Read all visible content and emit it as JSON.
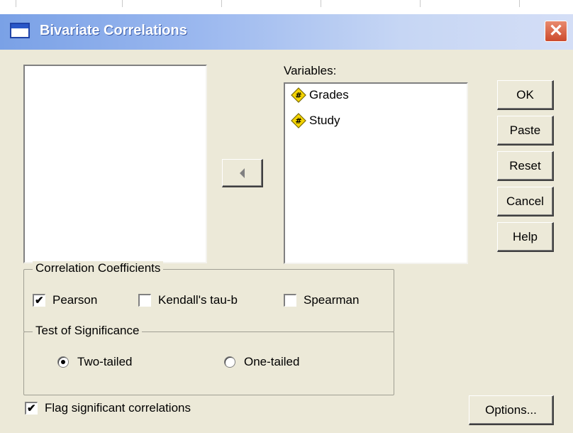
{
  "window": {
    "title": "Bivariate Correlations",
    "close_glyph": "✕"
  },
  "variables": {
    "label": "Variables:",
    "items": [
      {
        "name": "Grades",
        "icon": "numeric-variable-icon"
      },
      {
        "name": "Study",
        "icon": "numeric-variable-icon"
      }
    ]
  },
  "buttons": {
    "ok": "OK",
    "paste": "Paste",
    "reset": "Reset",
    "cancel": "Cancel",
    "help": "Help",
    "options": "Options..."
  },
  "correlation_coefficients": {
    "legend": "Correlation Coefficients",
    "pearson": {
      "label": "Pearson",
      "checked": true
    },
    "kendall": {
      "label": "Kendall's tau-b",
      "checked": false
    },
    "spearman": {
      "label": "Spearman",
      "checked": false
    }
  },
  "test_of_significance": {
    "legend": "Test of Significance",
    "two_tailed": {
      "label": "Two-tailed",
      "selected": true
    },
    "one_tailed": {
      "label": "One-tailed",
      "selected": false
    }
  },
  "flag_significant": {
    "label": "Flag significant correlations",
    "checked": true
  },
  "colors": {
    "dialog_bg": "#ece9d8",
    "title_gradient_start": "#7aa1e6",
    "title_gradient_end": "#d4def6",
    "close_button": "#cc4a2c"
  }
}
